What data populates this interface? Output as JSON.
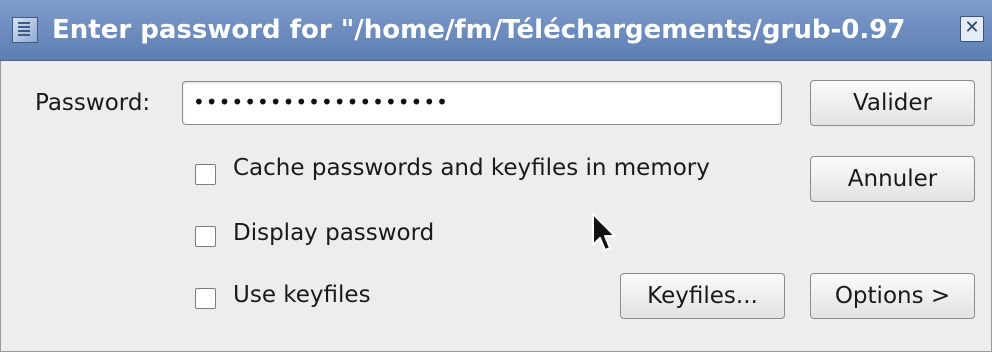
{
  "window": {
    "title": "Enter password for \"/home/fm/Téléchargements/grub-0.97",
    "close_glyph": "✕",
    "app_icon": "truecrypt-app-icon",
    "colors": {
      "titlebar": "#6a8bc0",
      "background": "#ededed"
    }
  },
  "form": {
    "password_label": "Password:",
    "password_value": "••••••••••••••••••••"
  },
  "buttons": {
    "ok": "Valider",
    "cancel": "Annuler",
    "keyfiles": "Keyfiles...",
    "options": "Options >"
  },
  "options": {
    "cache": {
      "label": "Cache passwords and keyfiles in memory",
      "checked": false
    },
    "display_password": {
      "label": "Display password",
      "checked": false
    },
    "use_keyfiles": {
      "label": "Use keyfiles",
      "checked": false
    }
  }
}
